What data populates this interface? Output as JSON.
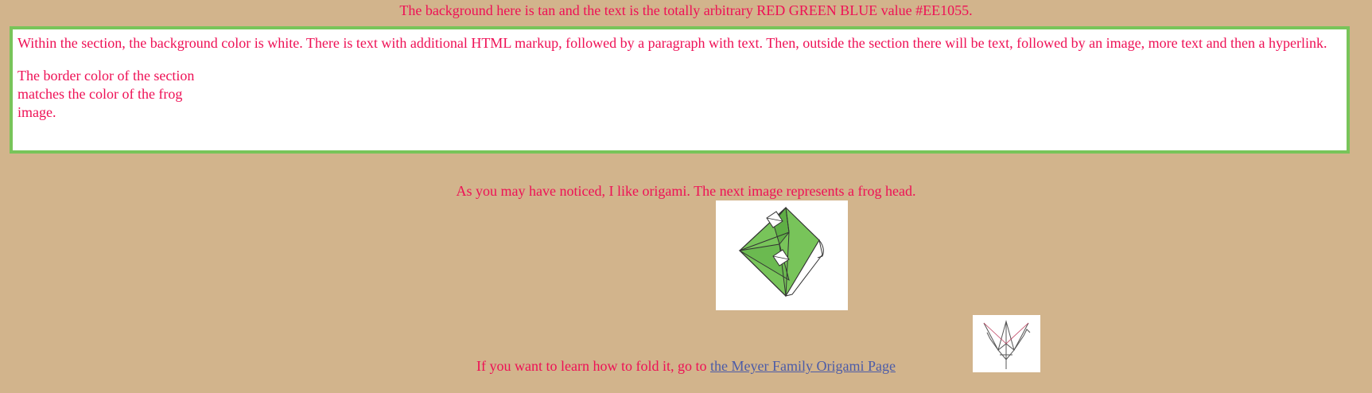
{
  "page": {
    "top_text": "The background here is tan and the text is the totally arbitrary RED GREEN BLUE value #EE1055.",
    "section": {
      "paragraph_1": "Within the section, the background color is white. There is text with additional HTML markup, followed by a paragraph with text. Then, outside the section there will be text, followed by an image, more text and then a hyperlink.",
      "paragraph_2": "The border color of the section matches the color of the frog image."
    },
    "middle_text": "As you may have noticed, I like origami. The next image represents a frog head.",
    "bottom_text_prefix": "If you want to learn how to fold it, go to ",
    "link_text": "the Meyer Family Origami Page "
  },
  "colors": {
    "background": "#D2B48C",
    "text": "#EE1055",
    "section_border": "#78C45A",
    "section_background": "#FFFFFF",
    "link": "#4B5BA8",
    "frog_green": "#78C45A"
  },
  "images": {
    "frog": "frog-head-origami-image",
    "crane": "origami-crane-image"
  }
}
